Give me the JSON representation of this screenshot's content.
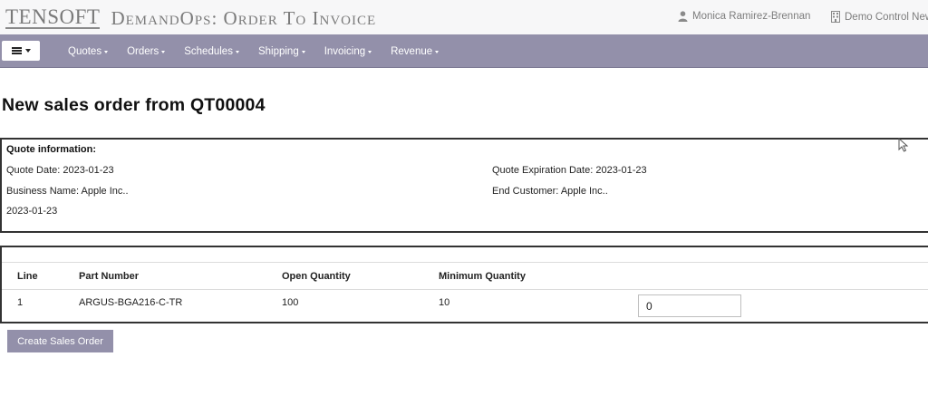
{
  "header": {
    "logo_text": "TENSOFT",
    "app_title": "DemandOps: Order To Invoice",
    "user_name": "Monica Ramirez-Brennan",
    "company_name": "Demo Control New",
    "user_icon": "user-icon",
    "company_icon": "building-icon"
  },
  "nav": {
    "menu_icon": "hamburger-icon",
    "items": [
      {
        "label": "Quotes"
      },
      {
        "label": "Orders"
      },
      {
        "label": "Schedules"
      },
      {
        "label": "Shipping"
      },
      {
        "label": "Invoicing"
      },
      {
        "label": "Revenue"
      }
    ]
  },
  "page": {
    "title": "New sales order from QT00004"
  },
  "quote_info": {
    "heading": "Quote information:",
    "quote_date": "Quote Date: 2023-01-23",
    "expiration_date": "Quote Expiration Date: 2023-01-23",
    "business_name": "Business Name: Apple Inc..",
    "end_customer": "End Customer: Apple Inc..",
    "extra_date": "2023-01-23"
  },
  "lines_table": {
    "columns": [
      "Line",
      "Part Number",
      "Open Quantity",
      "Minimum Quantity"
    ],
    "rows": [
      {
        "line": "1",
        "part_number": "ARGUS-BGA216-C-TR",
        "open_quantity": "100",
        "minimum_quantity": "10",
        "order_quantity": "0"
      }
    ]
  },
  "actions": {
    "create_label": "Create Sales Order"
  },
  "colors": {
    "nav_bg": "#9390aa",
    "button_bg": "#9390aa",
    "header_bg": "#f7f7f8"
  }
}
